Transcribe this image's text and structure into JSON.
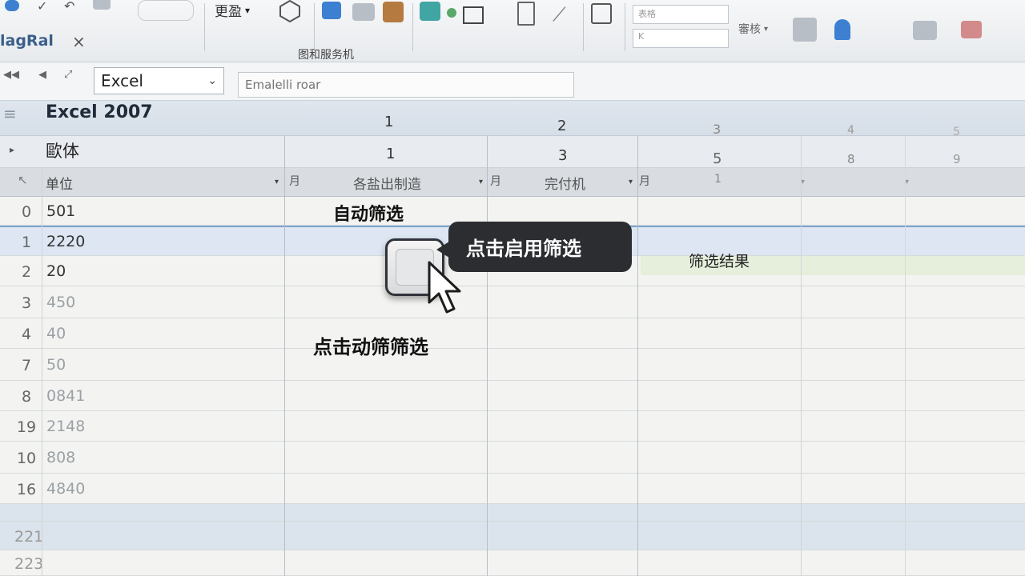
{
  "ribbon": {
    "group_label": "更盈",
    "box_top": "表格",
    "box_bottom": "K",
    "right_label": "審核"
  },
  "tab": {
    "label": "lagRal",
    "close_glyph": "×"
  },
  "window_title": "图和服务机",
  "toolbar": {
    "app_select": "Excel",
    "formula_placeholder": "Emalelli roar"
  },
  "version": "Excel 2007",
  "column_numbers_top": [
    "1",
    "2",
    "3",
    "4",
    "5"
  ],
  "column_numbers_second": [
    "1",
    "3",
    "5",
    "8",
    "9"
  ],
  "font_label": "歐体",
  "headers": {
    "unit": "单位",
    "col1_prefix": "月",
    "col1": "各盐出制造",
    "col2_prefix": "月",
    "col2": "完付机",
    "col3_prefix": "月",
    "col3": "1"
  },
  "rows": [
    {
      "num": "0",
      "val": "501"
    },
    {
      "num": "1",
      "val": "2220"
    },
    {
      "num": "2",
      "val": "20"
    },
    {
      "num": "3",
      "val": "450"
    },
    {
      "num": "4",
      "val": "40"
    },
    {
      "num": "7",
      "val": "50"
    },
    {
      "num": "8",
      "val": "0841"
    },
    {
      "num": "19",
      "val": "2148"
    },
    {
      "num": "10",
      "val": "808"
    },
    {
      "num": "16",
      "val": "4840"
    },
    {
      "num": "",
      "val": ""
    },
    {
      "num": "221",
      "val": ""
    },
    {
      "num": "223",
      "val": ""
    }
  ],
  "annotations": {
    "auto_filter": "自动筛选",
    "tooltip": "点击启用筛选",
    "click_hint": "点击动筛筛选",
    "result": "筛选结果"
  }
}
